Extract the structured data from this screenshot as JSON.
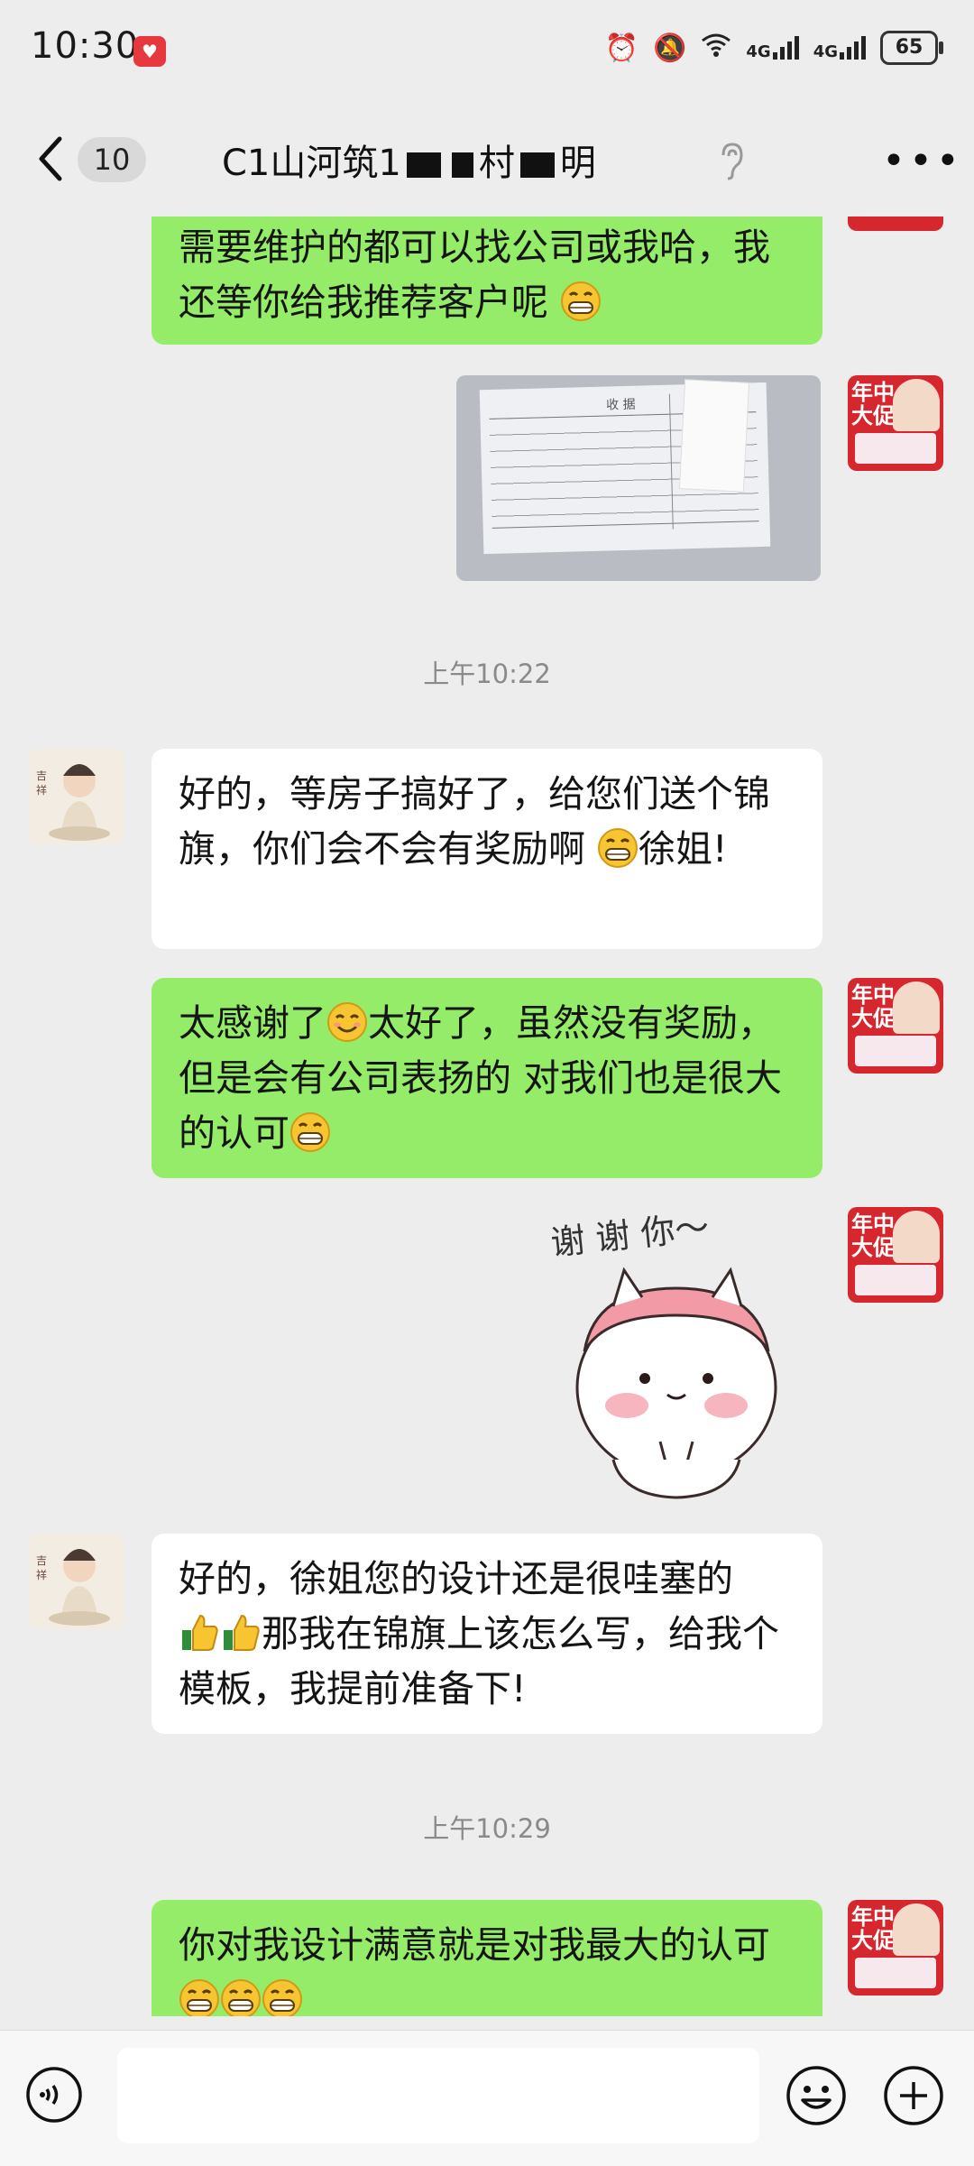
{
  "status_bar": {
    "time": "10:30",
    "battery": "65",
    "network": "4G"
  },
  "nav": {
    "badge": "10",
    "title_prefix": "C1山河筑1",
    "title_mid": "村",
    "title_suffix": "明"
  },
  "messages": [
    {
      "side": "out",
      "text": "需要维护的都可以找公司或我哈，我还等你给我推荐客户呢",
      "emoji_count": 1
    },
    {
      "side": "out",
      "type": "image"
    },
    {
      "type": "time",
      "text": "上午10:22"
    },
    {
      "side": "in",
      "text": "好的，等房子搞好了，给您们送个锦旗，你们会不会有奖励啊",
      "tail": "徐姐!"
    },
    {
      "side": "out",
      "part1": "太感谢了",
      "part2": "太好了，虽然没有奖励，但是会有公司表扬的 对我们也是很大的认可"
    },
    {
      "side": "out",
      "type": "sticker",
      "caption": "谢 谢 你～"
    },
    {
      "side": "in",
      "line1": "好的，徐姐您的设计还是很哇塞的",
      "line2": "那我在锦旗上该怎么写，给我个模板，我提前准备下!"
    },
    {
      "type": "time",
      "text": "上午10:29"
    },
    {
      "side": "out",
      "text": "你对我设计满意就是对我最大的认可"
    }
  ],
  "avatar_self": {
    "line1": "年中",
    "line2": "大促"
  },
  "receipt": {
    "title": "收 据"
  },
  "colors": {
    "out_bubble": "#95ec69",
    "in_bubble": "#ffffff",
    "background": "#ededed",
    "avatar_red": "#d6262e"
  }
}
